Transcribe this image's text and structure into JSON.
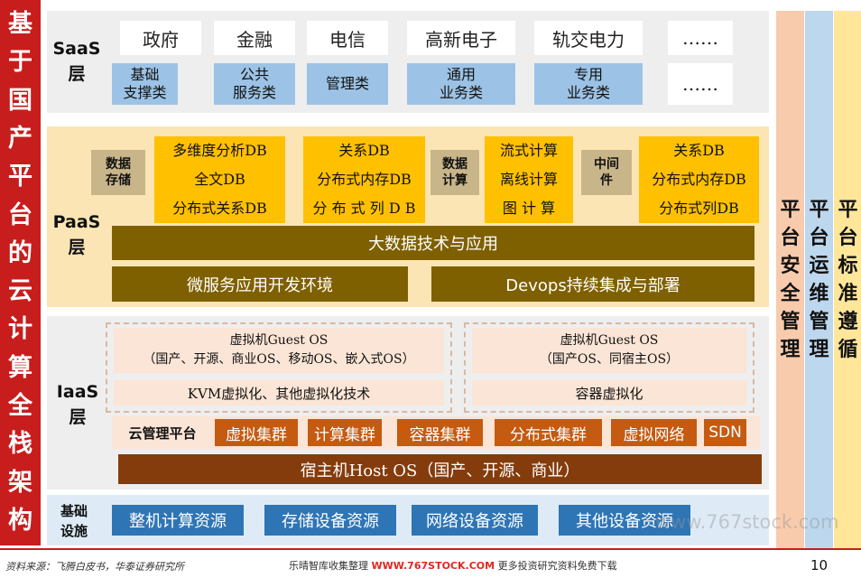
{
  "title_chars": [
    "基",
    "于",
    "国",
    "产",
    "平",
    "台",
    "的",
    "云",
    "计",
    "算",
    "全",
    "栈",
    "架",
    "构"
  ],
  "saas": {
    "label": "SaaS\n层",
    "row1": [
      "政府",
      "金融",
      "电信",
      "高新电子",
      "轨交电力",
      "……"
    ],
    "row2": [
      "基础\n支撑类",
      "公共\n服务类",
      "管理类",
      "通用\n业务类",
      "专用\n业务类",
      "……"
    ]
  },
  "paas": {
    "label": "PaaS\n层",
    "storage_label": "数据\n存储",
    "storage_dbs": [
      "多维度分析DB",
      "全文DB",
      "分布式关系DB"
    ],
    "storage_dbs2": [
      "关系DB",
      "分布式内存DB",
      "分 布 式 列 D B"
    ],
    "compute_label": "数据\n计算",
    "compute_items": [
      "流式计算",
      "离线计算",
      "图 计 算"
    ],
    "middleware_label": "中间\n件",
    "middleware_items": [
      "关系DB",
      "分布式内存DB",
      "分布式列DB"
    ],
    "bigdata": "大数据技术与应用",
    "microservice": "微服务应用开发环境",
    "devops": "Devops持续集成与部署"
  },
  "iaas": {
    "label": "IaaS\n层",
    "vm_left": "虚拟机Guest OS\n（国产、开源、商业OS、移动OS、嵌入式OS）",
    "kvm": "KVM虚拟化、其他虚拟化技术",
    "vm_right": "虚拟机Guest OS\n（国产OS、同宿主OS）",
    "container_virt": "容器虚拟化",
    "cloud_mgmt_label": "云管理平台",
    "cloud_items": [
      "虚拟集群",
      "计算集群",
      "容器集群",
      "分布式集群",
      "虚拟网络",
      "SDN"
    ],
    "host_os": "宿主机Host OS（国产、开源、商业）"
  },
  "infra": {
    "label": "基础\n设施",
    "items": [
      "整机计算资源",
      "存储设备资源",
      "网络设备资源",
      "其他设备资源"
    ]
  },
  "side_columns": [
    "平台安全管理",
    "平台运维管理",
    "平台标准遵循"
  ],
  "side_colors": [
    "#f8cbad",
    "#bdd7ee",
    "#ffe699"
  ],
  "footer": {
    "source": "资料来源：飞腾白皮书，华泰证券研究所",
    "notice_prefix": "乐晴智库收集整理",
    "notice_site": "WWW.767STOCK.COM",
    "notice_suffix": "更多投资研究资料免费下载",
    "page": "10",
    "watermark": "www.767stock.com"
  }
}
